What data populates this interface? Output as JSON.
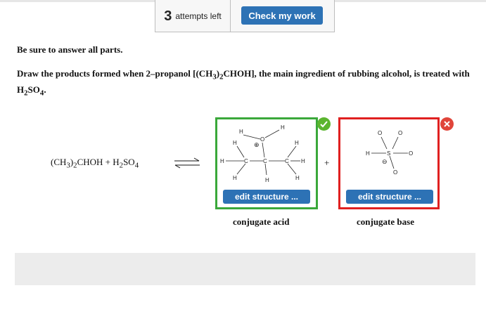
{
  "header": {
    "attempts_number": "3",
    "attempts_label": "attempts left",
    "check_button": "Check my work"
  },
  "instruction": "Be sure to answer all parts.",
  "question": {
    "part1": "Draw the products formed when 2–propanol [(CH",
    "sub1": "3",
    "part2": ")",
    "sub2": "2",
    "part3": "CHOH], the main ingredient of rubbing alcohol, is treated with H",
    "sub3": "2",
    "part4": "SO",
    "sub4": "4",
    "part5": "."
  },
  "equation": {
    "t1": "(CH",
    "s1": "3",
    "t2": ")",
    "s2": "2",
    "t3": "CHOH + H",
    "s3": "2",
    "t4": "SO",
    "s4": "4"
  },
  "plus_sign": "+",
  "acid_structure": {
    "atoms": [
      "H",
      "H",
      "O",
      "⊕",
      "H",
      "H",
      "H",
      "C",
      "C",
      "C",
      "H",
      "H",
      "H",
      "H"
    ]
  },
  "base_structure": {
    "atoms": [
      "O",
      "O",
      "H",
      "S",
      "O",
      "⊖",
      "O"
    ]
  },
  "edit_button_label": "edit structure ...",
  "acid_label": "conjugate acid",
  "base_label": "conjugate base",
  "status": {
    "acid": "correct",
    "base": "incorrect"
  },
  "colors": {
    "button_blue": "#2d72b5",
    "correct_green": "#3aa83a",
    "incorrect_red": "#e02020"
  }
}
